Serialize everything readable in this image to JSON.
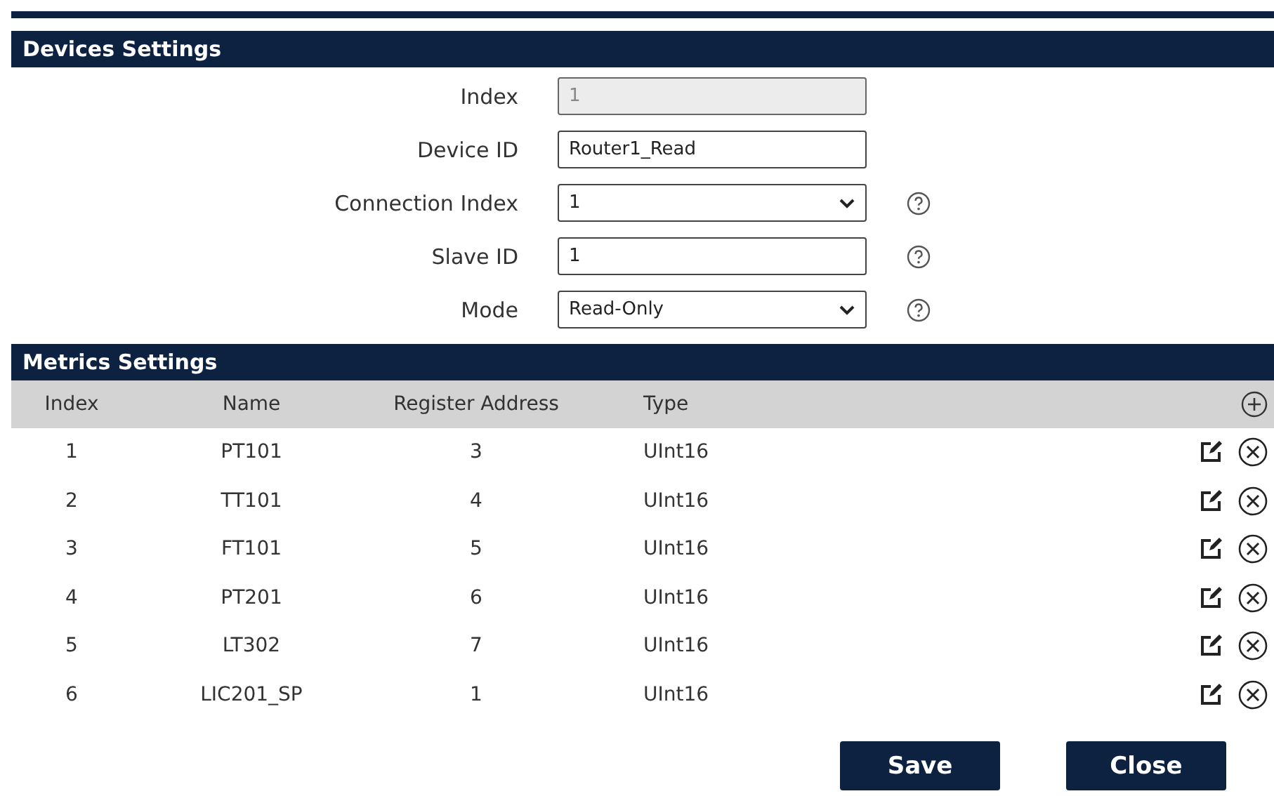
{
  "devices_settings": {
    "title": "Devices Settings",
    "fields": [
      {
        "label": "Index",
        "kind": "text",
        "value": "1",
        "disabled": true,
        "help": false
      },
      {
        "label": "Device ID",
        "kind": "text",
        "value": "Router1_Read",
        "disabled": false,
        "help": false
      },
      {
        "label": "Connection Index",
        "kind": "select",
        "value": "1",
        "disabled": false,
        "help": true
      },
      {
        "label": "Slave ID",
        "kind": "text",
        "value": "1",
        "disabled": false,
        "help": true
      },
      {
        "label": "Mode",
        "kind": "select",
        "value": "Read-Only",
        "disabled": false,
        "help": true
      }
    ]
  },
  "metrics_settings": {
    "title": "Metrics Settings",
    "columns": [
      "Index",
      "Name",
      "Register Address",
      "Type"
    ],
    "rows": [
      [
        "1",
        "PT101",
        "3",
        "UInt16"
      ],
      [
        "2",
        "TT101",
        "4",
        "UInt16"
      ],
      [
        "3",
        "FT101",
        "5",
        "UInt16"
      ],
      [
        "4",
        "PT201",
        "6",
        "UInt16"
      ],
      [
        "5",
        "LT302",
        "7",
        "UInt16"
      ],
      [
        "6",
        "LIC201_SP",
        "1",
        "UInt16"
      ]
    ]
  },
  "buttons": [
    "Save",
    "Close"
  ]
}
